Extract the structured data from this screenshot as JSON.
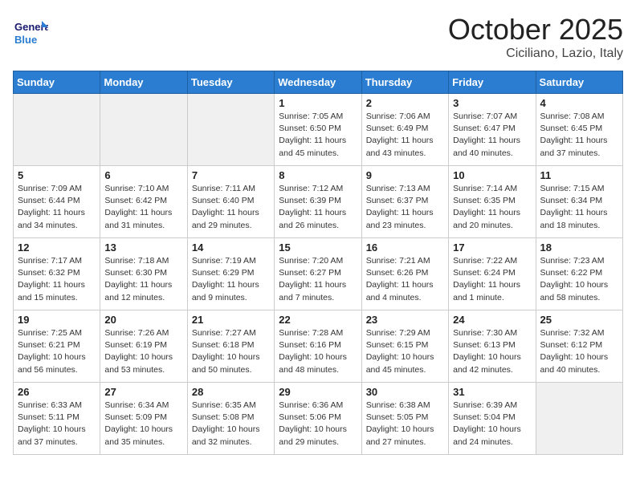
{
  "header": {
    "logo_general": "General",
    "logo_blue": "Blue",
    "month": "October 2025",
    "location": "Ciciliano, Lazio, Italy"
  },
  "weekdays": [
    "Sunday",
    "Monday",
    "Tuesday",
    "Wednesday",
    "Thursday",
    "Friday",
    "Saturday"
  ],
  "weeks": [
    [
      {
        "day": "",
        "sunrise": "",
        "sunset": "",
        "daylight": "",
        "empty": true
      },
      {
        "day": "",
        "sunrise": "",
        "sunset": "",
        "daylight": "",
        "empty": true
      },
      {
        "day": "",
        "sunrise": "",
        "sunset": "",
        "daylight": "",
        "empty": true
      },
      {
        "day": "1",
        "sunrise": "Sunrise: 7:05 AM",
        "sunset": "Sunset: 6:50 PM",
        "daylight": "Daylight: 11 hours and 45 minutes."
      },
      {
        "day": "2",
        "sunrise": "Sunrise: 7:06 AM",
        "sunset": "Sunset: 6:49 PM",
        "daylight": "Daylight: 11 hours and 43 minutes."
      },
      {
        "day": "3",
        "sunrise": "Sunrise: 7:07 AM",
        "sunset": "Sunset: 6:47 PM",
        "daylight": "Daylight: 11 hours and 40 minutes."
      },
      {
        "day": "4",
        "sunrise": "Sunrise: 7:08 AM",
        "sunset": "Sunset: 6:45 PM",
        "daylight": "Daylight: 11 hours and 37 minutes."
      }
    ],
    [
      {
        "day": "5",
        "sunrise": "Sunrise: 7:09 AM",
        "sunset": "Sunset: 6:44 PM",
        "daylight": "Daylight: 11 hours and 34 minutes."
      },
      {
        "day": "6",
        "sunrise": "Sunrise: 7:10 AM",
        "sunset": "Sunset: 6:42 PM",
        "daylight": "Daylight: 11 hours and 31 minutes."
      },
      {
        "day": "7",
        "sunrise": "Sunrise: 7:11 AM",
        "sunset": "Sunset: 6:40 PM",
        "daylight": "Daylight: 11 hours and 29 minutes."
      },
      {
        "day": "8",
        "sunrise": "Sunrise: 7:12 AM",
        "sunset": "Sunset: 6:39 PM",
        "daylight": "Daylight: 11 hours and 26 minutes."
      },
      {
        "day": "9",
        "sunrise": "Sunrise: 7:13 AM",
        "sunset": "Sunset: 6:37 PM",
        "daylight": "Daylight: 11 hours and 23 minutes."
      },
      {
        "day": "10",
        "sunrise": "Sunrise: 7:14 AM",
        "sunset": "Sunset: 6:35 PM",
        "daylight": "Daylight: 11 hours and 20 minutes."
      },
      {
        "day": "11",
        "sunrise": "Sunrise: 7:15 AM",
        "sunset": "Sunset: 6:34 PM",
        "daylight": "Daylight: 11 hours and 18 minutes."
      }
    ],
    [
      {
        "day": "12",
        "sunrise": "Sunrise: 7:17 AM",
        "sunset": "Sunset: 6:32 PM",
        "daylight": "Daylight: 11 hours and 15 minutes."
      },
      {
        "day": "13",
        "sunrise": "Sunrise: 7:18 AM",
        "sunset": "Sunset: 6:30 PM",
        "daylight": "Daylight: 11 hours and 12 minutes."
      },
      {
        "day": "14",
        "sunrise": "Sunrise: 7:19 AM",
        "sunset": "Sunset: 6:29 PM",
        "daylight": "Daylight: 11 hours and 9 minutes."
      },
      {
        "day": "15",
        "sunrise": "Sunrise: 7:20 AM",
        "sunset": "Sunset: 6:27 PM",
        "daylight": "Daylight: 11 hours and 7 minutes."
      },
      {
        "day": "16",
        "sunrise": "Sunrise: 7:21 AM",
        "sunset": "Sunset: 6:26 PM",
        "daylight": "Daylight: 11 hours and 4 minutes."
      },
      {
        "day": "17",
        "sunrise": "Sunrise: 7:22 AM",
        "sunset": "Sunset: 6:24 PM",
        "daylight": "Daylight: 11 hours and 1 minute."
      },
      {
        "day": "18",
        "sunrise": "Sunrise: 7:23 AM",
        "sunset": "Sunset: 6:22 PM",
        "daylight": "Daylight: 10 hours and 58 minutes."
      }
    ],
    [
      {
        "day": "19",
        "sunrise": "Sunrise: 7:25 AM",
        "sunset": "Sunset: 6:21 PM",
        "daylight": "Daylight: 10 hours and 56 minutes."
      },
      {
        "day": "20",
        "sunrise": "Sunrise: 7:26 AM",
        "sunset": "Sunset: 6:19 PM",
        "daylight": "Daylight: 10 hours and 53 minutes."
      },
      {
        "day": "21",
        "sunrise": "Sunrise: 7:27 AM",
        "sunset": "Sunset: 6:18 PM",
        "daylight": "Daylight: 10 hours and 50 minutes."
      },
      {
        "day": "22",
        "sunrise": "Sunrise: 7:28 AM",
        "sunset": "Sunset: 6:16 PM",
        "daylight": "Daylight: 10 hours and 48 minutes."
      },
      {
        "day": "23",
        "sunrise": "Sunrise: 7:29 AM",
        "sunset": "Sunset: 6:15 PM",
        "daylight": "Daylight: 10 hours and 45 minutes."
      },
      {
        "day": "24",
        "sunrise": "Sunrise: 7:30 AM",
        "sunset": "Sunset: 6:13 PM",
        "daylight": "Daylight: 10 hours and 42 minutes."
      },
      {
        "day": "25",
        "sunrise": "Sunrise: 7:32 AM",
        "sunset": "Sunset: 6:12 PM",
        "daylight": "Daylight: 10 hours and 40 minutes."
      }
    ],
    [
      {
        "day": "26",
        "sunrise": "Sunrise: 6:33 AM",
        "sunset": "Sunset: 5:11 PM",
        "daylight": "Daylight: 10 hours and 37 minutes."
      },
      {
        "day": "27",
        "sunrise": "Sunrise: 6:34 AM",
        "sunset": "Sunset: 5:09 PM",
        "daylight": "Daylight: 10 hours and 35 minutes."
      },
      {
        "day": "28",
        "sunrise": "Sunrise: 6:35 AM",
        "sunset": "Sunset: 5:08 PM",
        "daylight": "Daylight: 10 hours and 32 minutes."
      },
      {
        "day": "29",
        "sunrise": "Sunrise: 6:36 AM",
        "sunset": "Sunset: 5:06 PM",
        "daylight": "Daylight: 10 hours and 29 minutes."
      },
      {
        "day": "30",
        "sunrise": "Sunrise: 6:38 AM",
        "sunset": "Sunset: 5:05 PM",
        "daylight": "Daylight: 10 hours and 27 minutes."
      },
      {
        "day": "31",
        "sunrise": "Sunrise: 6:39 AM",
        "sunset": "Sunset: 5:04 PM",
        "daylight": "Daylight: 10 hours and 24 minutes."
      },
      {
        "day": "",
        "sunrise": "",
        "sunset": "",
        "daylight": "",
        "empty": true
      }
    ]
  ]
}
